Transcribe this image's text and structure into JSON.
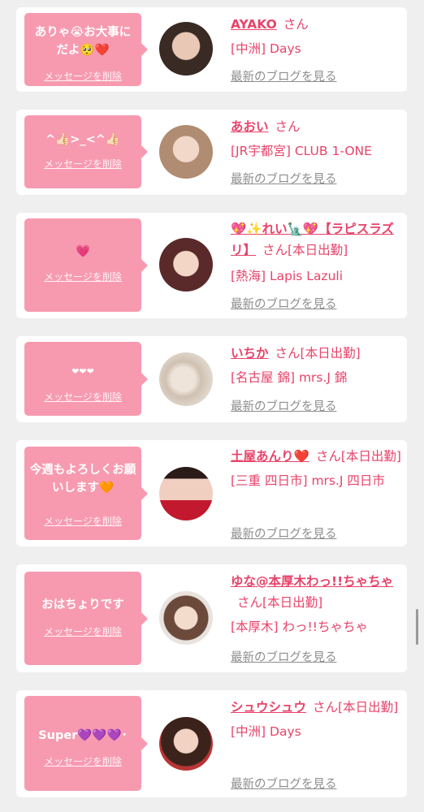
{
  "delete_label": "メッセージを削除",
  "blog_label": "最新のブログを見る",
  "san_label": "さん",
  "entries": [
    {
      "message": "ありゃ😭お大事にだよ🥺❤️",
      "name": "AYAKO",
      "status": "",
      "shop": "[中洲] Days"
    },
    {
      "message": "^👍🏻>_<^👍🏻",
      "name": "あおい",
      "status": "",
      "shop": "[JR宇都宮] CLUB 1-ONE"
    },
    {
      "message": "💗",
      "name": "💖✨れい🗽💖【ラピスラズリ】",
      "status": "[本日出勤]",
      "shop": "[熱海] Lapis Lazuli"
    },
    {
      "message": "❤❤❤",
      "name": "いちか",
      "status": "[本日出勤]",
      "shop": "[名古屋 錦] mrs.J 錦"
    },
    {
      "message": "今週もよろしくお願いします🧡",
      "name": "土屋あんり❤️",
      "status": "[本日出勤]",
      "shop": "[三重 四日市] mrs.J 四日市"
    },
    {
      "message": "おはちょりです",
      "name": "ゆな@本厚木わっ!!ちゃちゃ",
      "status": "[本日出勤]",
      "shop": "[本厚木] わっ!!ちゃちゃ"
    },
    {
      "message": "Super💜💜💜･",
      "name": "シュウシュウ",
      "status": "[本日出勤]",
      "shop": "[中洲] Days"
    }
  ],
  "colors": {
    "accent": "#e8436a",
    "bubble": "#f79ab0",
    "link_gray": "#8e8e8e",
    "background": "#efefef"
  }
}
